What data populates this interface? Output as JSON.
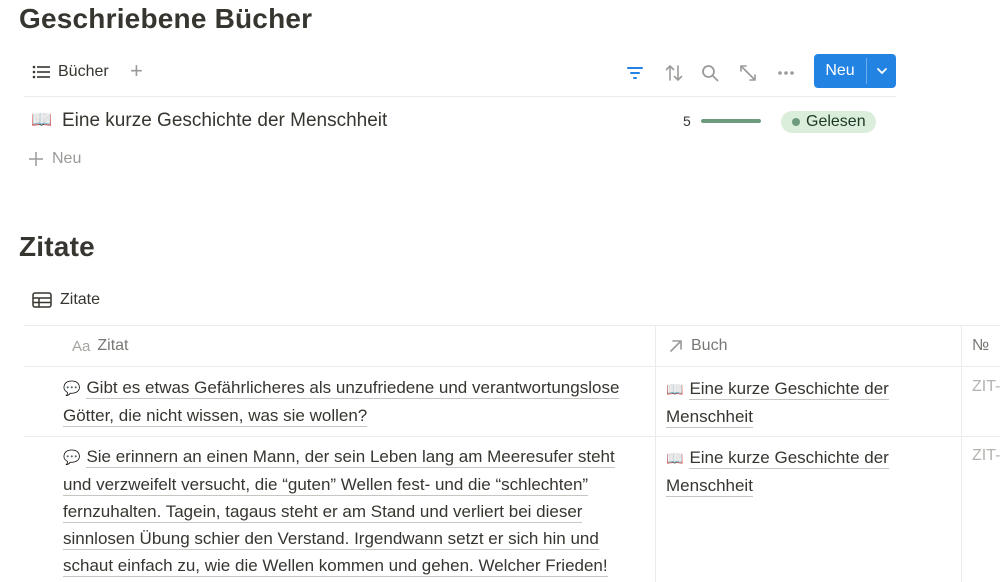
{
  "books_section": {
    "title": "Geschriebene Bücher",
    "view_label": "Bücher",
    "new_button_label": "Neu",
    "rows": [
      {
        "icon": "📖",
        "name": "Eine kurze Geschichte der Menschheit",
        "rating": "5",
        "rating_fraction": 1.0,
        "status": "Gelesen"
      }
    ],
    "new_row_label": "Neu"
  },
  "quotes_section": {
    "title": "Zitate",
    "view_label": "Zitate",
    "columns": {
      "quote": "Zitat",
      "quote_prefix": "Aa",
      "book": "Buch",
      "number": "№"
    },
    "rows": [
      {
        "icon": "💬",
        "line1": "Gibt es etwas Gefährlicheres als unzufriedene und verantwortungslose",
        "rest": [
          "Götter, die nicht wissen, was sie wollen?"
        ],
        "book_icon": "📖",
        "book_line1": "Eine kurze Geschichte der",
        "book_line2": "Menschheit",
        "id": "ZIT-"
      },
      {
        "icon": "💬",
        "line1": "Sie erinnern an einen Mann, der sein Leben lang am Meeresufer steht",
        "rest": [
          "und verzweifelt versucht, die “guten” Wellen fest- und die “schlechten”",
          "fernzuhalten. Tagein, tagaus steht er am Stand und verliert bei dieser",
          "sinnlosen Übung schier den Verstand. Irgendwann setzt er sich hin und",
          "schaut einfach zu, wie die Wellen kommen und gehen. Welcher Frieden!"
        ],
        "book_icon": "📖",
        "book_line1": "Eine kurze Geschichte der",
        "book_line2": "Menschheit",
        "id": "ZIT-"
      }
    ]
  },
  "colors": {
    "accent": "#2383e2",
    "status_bg": "#dbeddb",
    "status_dot": "#6c9b7d"
  }
}
